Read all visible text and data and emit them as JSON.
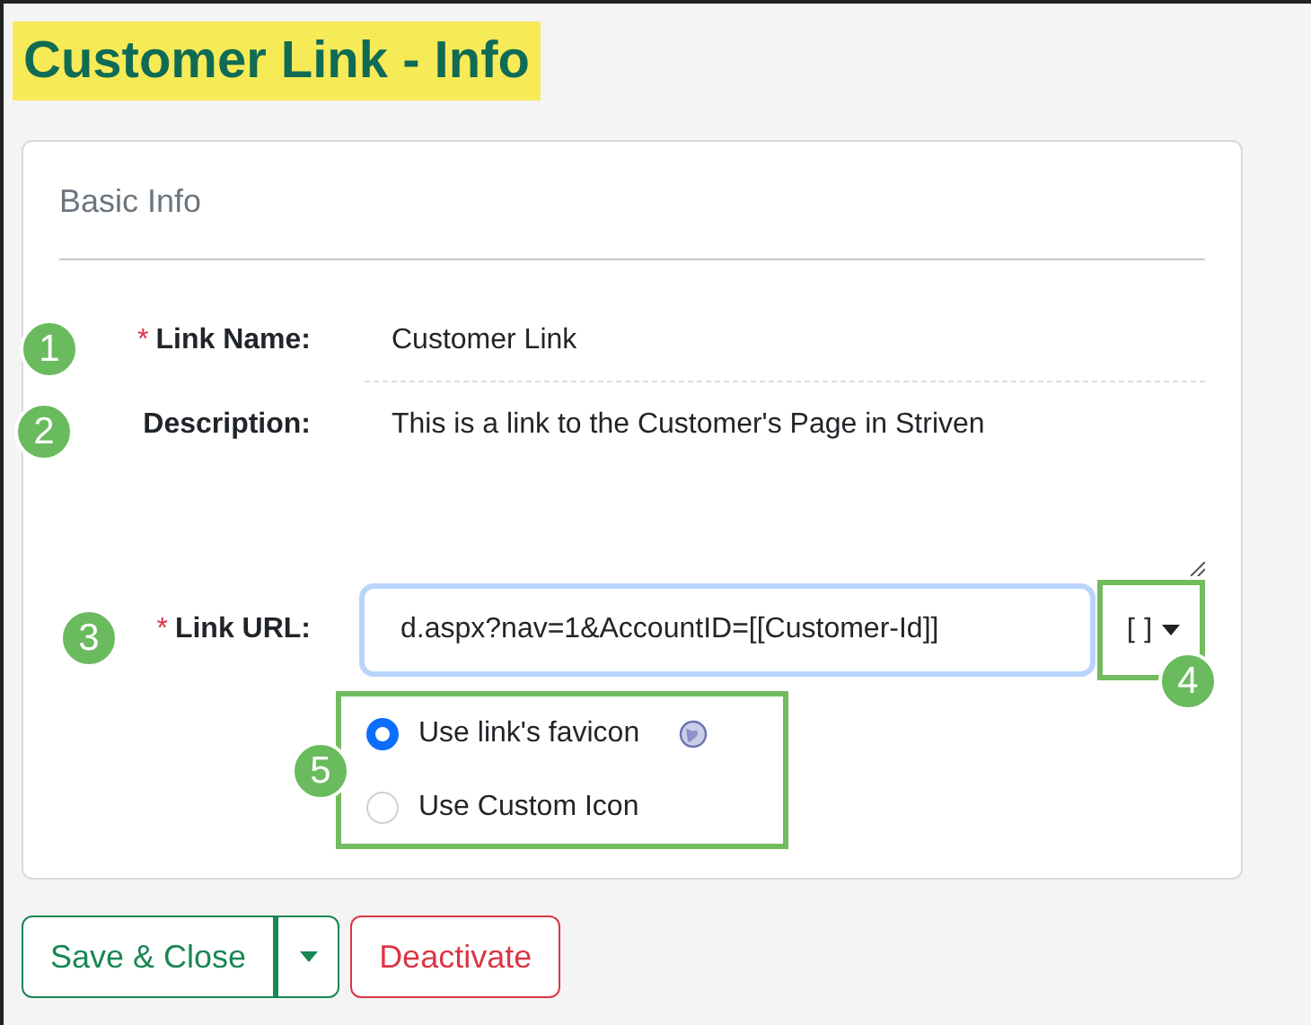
{
  "title": "Customer Link - Info",
  "section": {
    "title": "Basic Info"
  },
  "fields": [
    {
      "kind": "text",
      "required_mark": "*",
      "label": "Link Name:",
      "value": "Customer Link"
    },
    {
      "kind": "textarea",
      "label": "Description:",
      "value": "This is a link to the Customer's Page in Striven"
    },
    {
      "kind": "url",
      "required_mark": "*",
      "label": "Link URL:",
      "value": "d.aspx?nav=1&AccountID=[[Customer-Id]]",
      "token_button": {
        "label": "[]",
        "framed": true
      }
    }
  ],
  "icon_options": {
    "framed": true,
    "options": [
      {
        "kind": "favicon",
        "label": "Use link's favicon",
        "selected": true
      },
      {
        "kind": "custom",
        "label": "Use Custom Icon",
        "selected": false
      }
    ]
  },
  "buttons": [
    {
      "kind": "split",
      "label": "Save & Close"
    },
    {
      "kind": "danger",
      "label": "Deactivate"
    }
  ],
  "callouts": [
    {
      "label": "1"
    },
    {
      "label": "2"
    },
    {
      "label": "3"
    },
    {
      "label": "4"
    },
    {
      "label": "5"
    }
  ]
}
